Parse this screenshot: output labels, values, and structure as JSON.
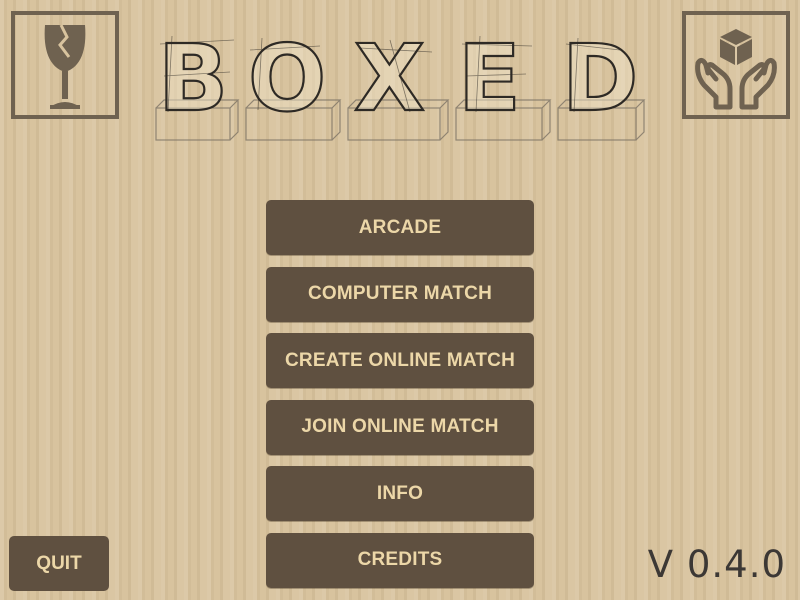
{
  "logo": {
    "text": "BOXED",
    "letters": [
      "B",
      "O",
      "X",
      "E",
      "D"
    ]
  },
  "icons": {
    "left": "fragile-glass-icon",
    "right": "handle-with-care-icon"
  },
  "menu": {
    "buttons": [
      {
        "label": "ARCADE"
      },
      {
        "label": "COMPUTER MATCH"
      },
      {
        "label": "CREATE ONLINE MATCH"
      },
      {
        "label": "JOIN ONLINE MATCH"
      },
      {
        "label": "INFO"
      },
      {
        "label": "CREDITS"
      }
    ]
  },
  "quit": {
    "label": "QUIT"
  },
  "version": {
    "label": "V 0.4.0"
  },
  "colors": {
    "background": "#d8c39e",
    "button": "#5f5040",
    "button_text": "#ecd7a8",
    "icon": "#6f6250",
    "version_text": "#3c3835"
  }
}
